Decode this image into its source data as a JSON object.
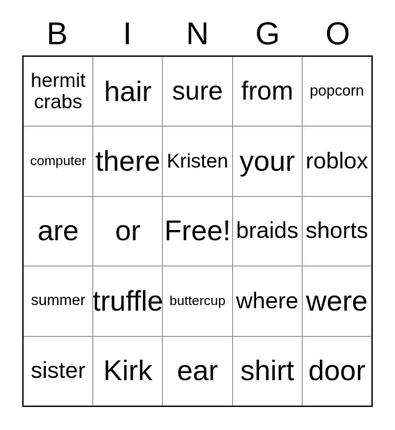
{
  "card": {
    "title": "BINGO",
    "header": [
      "B",
      "I",
      "N",
      "G",
      "O"
    ],
    "free_space_label": "Free!",
    "colors": {
      "text": "#000000",
      "outer_border": "#2b2b2b",
      "inner_border": "#8a8a8a",
      "background": "#ffffff"
    },
    "rows": [
      [
        {
          "text": "hermit\ncrabs",
          "size": "md"
        },
        {
          "text": "hair",
          "size": "2xl"
        },
        {
          "text": "sure",
          "size": "xl"
        },
        {
          "text": "from",
          "size": "xl"
        },
        {
          "text": "popcorn",
          "size": "sm"
        }
      ],
      [
        {
          "text": "computer",
          "size": "xs"
        },
        {
          "text": "there",
          "size": "2xl"
        },
        {
          "text": "Kristen",
          "size": "md"
        },
        {
          "text": "your",
          "size": "2xl"
        },
        {
          "text": "roblox",
          "size": "lg"
        }
      ],
      [
        {
          "text": "are",
          "size": "2xl"
        },
        {
          "text": "or",
          "size": "2xl"
        },
        {
          "text": "Free!",
          "size": "2xl"
        },
        {
          "text": "braids",
          "size": "lg"
        },
        {
          "text": "shorts",
          "size": "lg"
        }
      ],
      [
        {
          "text": "summer",
          "size": "sm"
        },
        {
          "text": "truffle",
          "size": "2xl"
        },
        {
          "text": "buttercup",
          "size": "xs"
        },
        {
          "text": "where",
          "size": "lg"
        },
        {
          "text": "were",
          "size": "2xl"
        }
      ],
      [
        {
          "text": "sister",
          "size": "lg"
        },
        {
          "text": "Kirk",
          "size": "2xl"
        },
        {
          "text": "ear",
          "size": "2xl"
        },
        {
          "text": "shirt",
          "size": "2xl"
        },
        {
          "text": "door",
          "size": "2xl"
        }
      ]
    ]
  }
}
